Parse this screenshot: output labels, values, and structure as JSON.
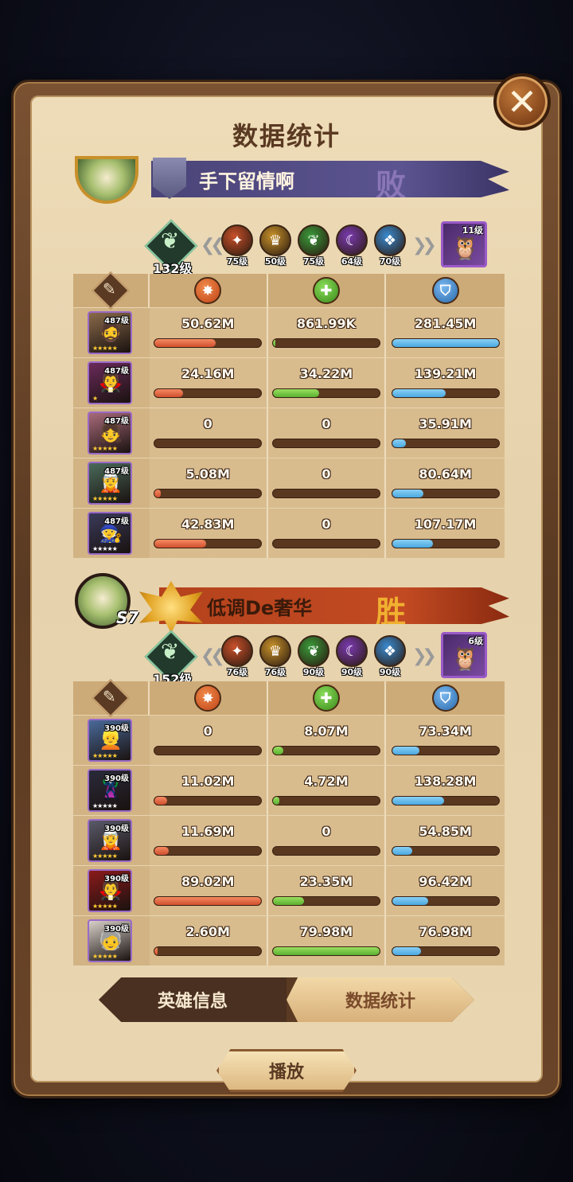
{
  "title": "数据统计",
  "close_icon": "✕",
  "team1": {
    "name": "手下留情啊",
    "result": "败",
    "faction_level": "132级",
    "factions": [
      {
        "lvl": "75级",
        "color": "#c8502a",
        "glyph": "✦"
      },
      {
        "lvl": "50级",
        "color": "#c8922a",
        "glyph": "♛"
      },
      {
        "lvl": "75级",
        "color": "#3a9a3a",
        "glyph": "❦"
      },
      {
        "lvl": "64级",
        "color": "#7a3ab0",
        "glyph": "☾"
      },
      {
        "lvl": "70级",
        "color": "#3a8ad0",
        "glyph": "❖"
      }
    ],
    "pet_level": "11级",
    "heroes": [
      {
        "lvl": "487级",
        "stars": "★★★★★",
        "star_white": false,
        "bg": "#8a6a4a",
        "face": "🧔",
        "dmg": "50.62M",
        "heal": "861.99K",
        "def": "281.45M",
        "dmg_pct": 0.57,
        "heal_pct": 0.02,
        "def_pct": 1.0
      },
      {
        "lvl": "487级",
        "stars": "★",
        "star_white": false,
        "bg": "#6a2a5a",
        "face": "🧛",
        "dmg": "24.16M",
        "heal": "34.22M",
        "def": "139.21M",
        "dmg_pct": 0.27,
        "heal_pct": 0.43,
        "def_pct": 0.5
      },
      {
        "lvl": "487级",
        "stars": "★★★★★",
        "star_white": false,
        "bg": "#a86a7a",
        "face": "👧",
        "dmg": "0",
        "heal": "0",
        "def": "35.91M",
        "dmg_pct": 0.0,
        "heal_pct": 0.0,
        "def_pct": 0.13
      },
      {
        "lvl": "487级",
        "stars": "★★★★★",
        "star_white": false,
        "bg": "#4a6a5a",
        "face": "🧝",
        "dmg": "5.08M",
        "heal": "0",
        "def": "80.64M",
        "dmg_pct": 0.06,
        "heal_pct": 0.0,
        "def_pct": 0.29
      },
      {
        "lvl": "487级",
        "stars": "★★★★★",
        "star_white": true,
        "bg": "#3a3a5a",
        "face": "🧙",
        "dmg": "42.83M",
        "heal": "0",
        "def": "107.17M",
        "dmg_pct": 0.48,
        "heal_pct": 0.0,
        "def_pct": 0.38
      }
    ]
  },
  "team2": {
    "name": "低调De奢华",
    "result": "胜",
    "rank_tag": "S7",
    "faction_level": "152级",
    "factions": [
      {
        "lvl": "76级",
        "color": "#c8502a",
        "glyph": "✦"
      },
      {
        "lvl": "76级",
        "color": "#c8922a",
        "glyph": "♛"
      },
      {
        "lvl": "90级",
        "color": "#3a9a3a",
        "glyph": "❦"
      },
      {
        "lvl": "90级",
        "color": "#7a3ab0",
        "glyph": "☾"
      },
      {
        "lvl": "90级",
        "color": "#3a8ad0",
        "glyph": "❖"
      }
    ],
    "pet_level": "6级",
    "heroes": [
      {
        "lvl": "390级",
        "stars": "★★★★★",
        "star_white": false,
        "bg": "#4a6a9a",
        "face": "👱",
        "dmg": "0",
        "heal": "8.07M",
        "def": "73.34M",
        "dmg_pct": 0.0,
        "heal_pct": 0.1,
        "def_pct": 0.26
      },
      {
        "lvl": "390级",
        "stars": "★★★★★",
        "star_white": true,
        "bg": "#2a2a3a",
        "face": "🦹",
        "dmg": "11.02M",
        "heal": "4.72M",
        "def": "138.28M",
        "dmg_pct": 0.12,
        "heal_pct": 0.06,
        "def_pct": 0.49
      },
      {
        "lvl": "390级",
        "stars": "★★★★★",
        "star_white": false,
        "bg": "#5a5a6a",
        "face": "🧝",
        "dmg": "11.69M",
        "heal": "0",
        "def": "54.85M",
        "dmg_pct": 0.13,
        "heal_pct": 0.0,
        "def_pct": 0.19
      },
      {
        "lvl": "390级",
        "stars": "★★★★★",
        "star_white": false,
        "bg": "#8a1a1a",
        "face": "🧛",
        "dmg": "89.02M",
        "heal": "23.35M",
        "def": "96.42M",
        "dmg_pct": 1.0,
        "heal_pct": 0.29,
        "def_pct": 0.34
      },
      {
        "lvl": "390级",
        "stars": "★★★★★",
        "star_white": false,
        "bg": "#d8d0c8",
        "face": "🧓",
        "dmg": "2.60M",
        "heal": "79.98M",
        "def": "76.98M",
        "dmg_pct": 0.03,
        "heal_pct": 1.0,
        "def_pct": 0.27
      }
    ]
  },
  "tabs": {
    "hero_info": "英雄信息",
    "stats": "数据统计"
  },
  "play_label": "播放",
  "icons": {
    "damage": "damage-icon",
    "heal": "heal-icon",
    "defense": "shield-icon",
    "scroll": "scroll-icon"
  }
}
